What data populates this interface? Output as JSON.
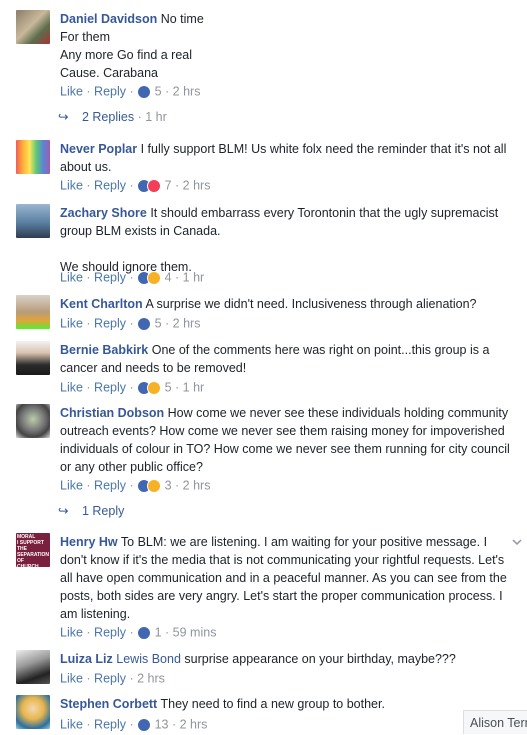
{
  "comments": [
    {
      "name": "Daniel Davidson",
      "text": "No time\nFor them\nAny more Go find a real\nCause. Carabana",
      "like": "Like",
      "reply": "Reply",
      "count": "5",
      "time": "2 hrs",
      "reactions": [
        "like"
      ],
      "replies": {
        "label": "2 Replies",
        "time": "1 hr"
      }
    },
    {
      "name": "Never Poplar",
      "text": "I fully support BLM! Us white folx need the reminder that it's not all about us.",
      "like": "Like",
      "reply": "Reply",
      "count": "7",
      "time": "2 hrs",
      "reactions": [
        "like",
        "love"
      ]
    },
    {
      "name": "Zachary Shore",
      "text": "It should embarrass every Torontonin that the ugly supremacist group BLM exists in Canada.\n\nWe should ignore them.",
      "like": "Like",
      "reply": "Reply",
      "count": "4",
      "time": "1 hr",
      "reactions": [
        "like",
        "haha"
      ]
    },
    {
      "name": "Kent Charlton",
      "text": "A surprise we didn't need. Inclusiveness through alienation?",
      "like": "Like",
      "reply": "Reply",
      "count": "5",
      "time": "2 hrs",
      "reactions": [
        "like"
      ]
    },
    {
      "name": "Bernie Babkirk",
      "text": "One of the comments here was right on point...this group is a cancer and needs to be removed!",
      "like": "Like",
      "reply": "Reply",
      "count": "5",
      "time": "1 hr",
      "reactions": [
        "like",
        "haha"
      ]
    },
    {
      "name": "Christian Dobson",
      "text": "How come we never see these individuals holding community outreach events? How come we never see them raising money for impoverished individuals of colour in TO? How come we never see them running for city council or any other public office?",
      "like": "Like",
      "reply": "Reply",
      "count": "3",
      "time": "2 hrs",
      "reactions": [
        "like",
        "haha"
      ],
      "replies": {
        "label": "1 Reply",
        "time": ""
      }
    },
    {
      "name": "Henry Hw",
      "text": "To BLM: we are listening. I am waiting for your positive message. I don't know if it's the media that is not communicating your rightful requests. Let's all have open communication and in a peaceful manner. As you can see from the posts, both sides are very angry. Let's start the proper communication process. I am listening.",
      "like": "Like",
      "reply": "Reply",
      "count": "1",
      "time": "59 mins",
      "reactions": [
        "like"
      ]
    },
    {
      "name": "Luiza Liz",
      "mention": "Lewis Bond",
      "text": "surprise appearance on your birthday, maybe???",
      "like": "Like",
      "reply": "Reply",
      "count": "",
      "time": "2 hrs",
      "reactions": []
    },
    {
      "name": "Stephen Corbett",
      "text": "They need to find a new group to bother.",
      "like": "Like",
      "reply": "Reply",
      "count": "13",
      "time": "2 hrs",
      "reactions": [
        "like"
      ]
    }
  ],
  "avatar_text": {
    "henry": "MORAL\nI SUPPORT THE\nSEPARATION OF\nCHURCH AND STATE"
  },
  "chat_corner": {
    "name": "Alison Terr"
  },
  "colors": {
    "name": "#365899",
    "like": "#4267b2",
    "love": "#f33e58",
    "haha": "#f7b125",
    "muted": "#90949c"
  }
}
